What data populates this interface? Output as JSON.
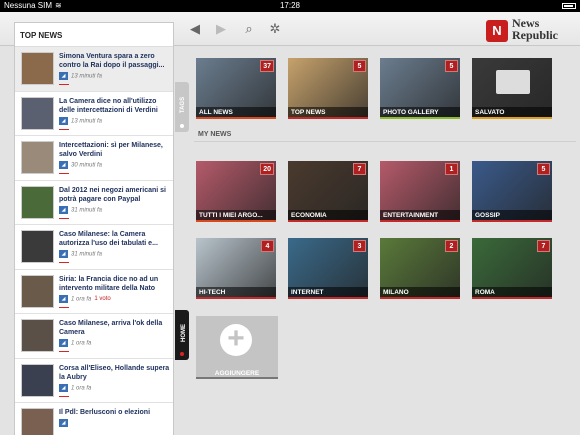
{
  "status_bar": {
    "carrier": "Nessuna SIM",
    "time": "17:28"
  },
  "app": {
    "logo_line1": "News",
    "logo_line2": "Republic"
  },
  "news_panel": {
    "header": "TOP NEWS",
    "items": [
      {
        "title": "Simona Ventura spara a zero contro la Rai dopo il passaggi...",
        "time": "13 minuti fa",
        "thumb_color": "#8a6a4a"
      },
      {
        "title": "La Camera dice no all'utilizzo delle intercettazioni di Verdini",
        "time": "13 minuti fa",
        "thumb_color": "#5a6070"
      },
      {
        "title": "Intercettazioni: sì per Milanese, salvo Verdini",
        "time": "30 minuti fa",
        "thumb_color": "#9a8a7a"
      },
      {
        "title": "Dal 2012 nei negozi americani si potrà pagare con Paypal",
        "time": "31 minuti fa",
        "thumb_color": "#4a6a3a"
      },
      {
        "title": "Caso Milanese: la Camera autorizza l'uso dei tabulati e...",
        "time": "31 minuti fa",
        "thumb_color": "#3a3a3a"
      },
      {
        "title": "Siria: la Francia dice no ad un intervento militare della Nato",
        "time": "1 ora fa",
        "votes": "1 voto",
        "thumb_color": "#6a5a4a"
      },
      {
        "title": "Caso Milanese, arriva l'ok della Camera",
        "time": "1 ora fa",
        "thumb_color": "#5a5048"
      },
      {
        "title": "Corsa all'Eliseo, Hollande supera la Aubry",
        "time": "1 ora fa",
        "thumb_color": "#3a4050"
      },
      {
        "title": "Il Pdl: Berlusconi o elezioni",
        "time": "",
        "thumb_color": "#7a6050"
      }
    ]
  },
  "handles": {
    "tags": "TAGS",
    "home": "HOME"
  },
  "featured": [
    {
      "label": "ALL NEWS",
      "badge": "37",
      "color": "#d84a1e",
      "img": "#6b7d8f"
    },
    {
      "label": "TOP NEWS",
      "badge": "5",
      "color": "#c52a2a",
      "img": "#c7a26c"
    },
    {
      "label": "PHOTO GALLERY",
      "badge": "5",
      "color": "#8cbb2a",
      "img": "#6b7d8f"
    },
    {
      "label": "SALVATO",
      "badge": "",
      "color": "#e0a11a",
      "img": "#3a3a3a"
    }
  ],
  "my_news_label": "MY NEWS",
  "my_news": [
    {
      "label": "TUTTI I MIEI ARGO...",
      "badge": "20",
      "color": "#d84a1e",
      "img": "#b55a6a"
    },
    {
      "label": "ECONOMIA",
      "badge": "7",
      "color": "#c52a2a",
      "img": "#4a3a2e"
    },
    {
      "label": "ENTERTAINMENT",
      "badge": "1",
      "color": "#c52a2a",
      "img": "#b55a6a"
    },
    {
      "label": "GOSSIP",
      "badge": "5",
      "color": "#c52a2a",
      "img": "#3a5a8a"
    },
    {
      "label": "HI-TECH",
      "badge": "4",
      "color": "#c52a2a",
      "img": "#b8c4cc"
    },
    {
      "label": "INTERNET",
      "badge": "3",
      "color": "#c52a2a",
      "img": "#3a6a8a"
    },
    {
      "label": "MILANO",
      "badge": "2",
      "color": "#c52a2a",
      "img": "#5a7a3a"
    },
    {
      "label": "ROMA",
      "badge": "7",
      "color": "#c52a2a",
      "img": "#3a6a3a"
    }
  ],
  "add_tile": {
    "label": "AGGIUNGERE"
  }
}
